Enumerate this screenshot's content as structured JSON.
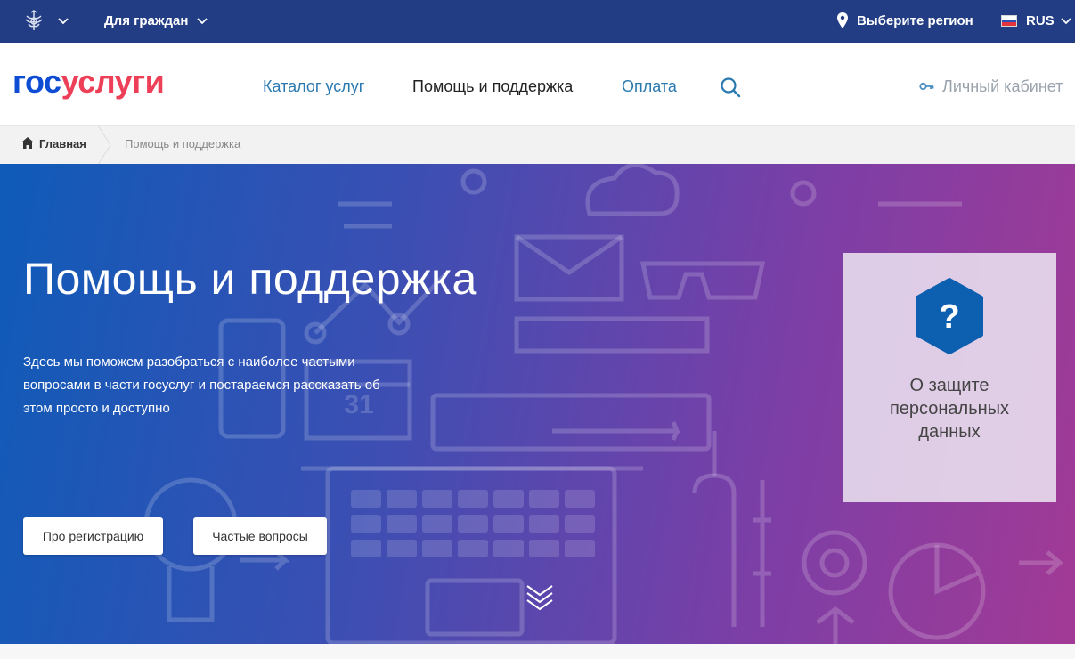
{
  "topbar": {
    "audience_label": "Для граждан",
    "region_label": "Выберите регион",
    "language_label": "RUS"
  },
  "header": {
    "logo_part1": "гос",
    "logo_part2": "услуги",
    "nav": {
      "catalog": "Каталог услуг",
      "help": "Помощь и поддержка",
      "payment": "Оплата"
    },
    "cabinet_label": "Личный кабинет"
  },
  "breadcrumb": {
    "home": "Главная",
    "current": "Помощь и поддержка"
  },
  "hero": {
    "title": "Помощь и поддержка",
    "description": "Здесь мы поможем разобраться с наиболее частыми вопросами в части госуслуг и постараемся рассказать об этом просто и доступно",
    "btn_registration": "Про регистрацию",
    "btn_faq": "Частые вопросы",
    "calendar_number": "31"
  },
  "card": {
    "text": "О защите персональных данных",
    "icon_char": "?"
  },
  "colors": {
    "topbar": "#223d83",
    "logo_blue": "#0d4cd3",
    "logo_red": "#ee3f58",
    "nav_link": "#2a7ab0",
    "hex_icon": "#0d5fb0"
  }
}
